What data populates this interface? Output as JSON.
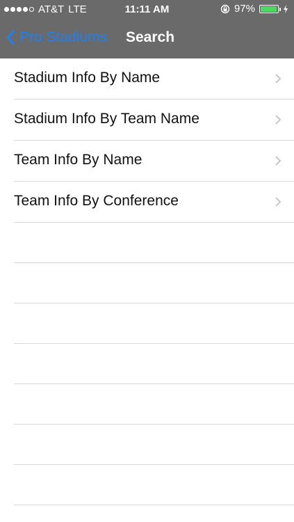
{
  "status_bar": {
    "carrier": "AT&T",
    "network": "LTE",
    "time": "11:11 AM",
    "battery": "97%",
    "battery_level": 0.97,
    "signal_dots_filled": 4,
    "signal_dots_total": 5
  },
  "nav": {
    "back_label": "Pro Stadiums",
    "title": "Search"
  },
  "menu": {
    "items": [
      {
        "label": "Stadium Info By Name"
      },
      {
        "label": "Stadium Info By Team Name"
      },
      {
        "label": "Team Info By Name"
      },
      {
        "label": "Team Info By Conference"
      }
    ]
  },
  "colors": {
    "bar": "#6a6a6a",
    "accent": "#1a82f7",
    "battery": "#4cd964",
    "separator": "#d9d9d9",
    "chevron": "#c7c7cc"
  }
}
